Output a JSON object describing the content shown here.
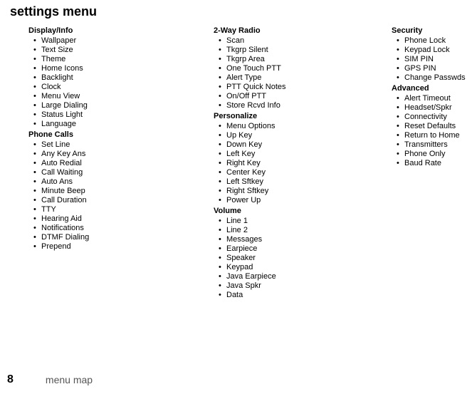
{
  "title": "settings menu",
  "footer": {
    "page": "8",
    "label": "menu map"
  },
  "cols": [
    {
      "sections": [
        {
          "heading": "Display/Info",
          "items": [
            "Wallpaper",
            "Text Size",
            "Theme",
            "Home Icons",
            "Backlight",
            "Clock",
            "Menu View",
            "Large Dialing",
            "Status Light",
            "Language"
          ]
        },
        {
          "heading": "Phone Calls",
          "items": [
            "Set Line",
            "Any Key Ans",
            "Auto Redial",
            "Call Waiting",
            "Auto Ans",
            "Minute Beep",
            "Call Duration",
            "TTY",
            "Hearing Aid",
            "Notifications",
            "DTMF Dialing",
            "Prepend"
          ]
        }
      ]
    },
    {
      "sections": [
        {
          "heading": "2-Way Radio",
          "items": [
            "Scan",
            "Tkgrp Silent",
            "Tkgrp Area",
            "One Touch PTT",
            "Alert Type",
            "PTT Quick Notes",
            "On/Off PTT",
            "Store Rcvd Info"
          ]
        },
        {
          "heading": "Personalize",
          "items": [
            "Menu Options",
            "Up Key",
            "Down Key",
            "Left Key",
            "Right Key",
            "Center Key",
            "Left Sftkey",
            "Right Sftkey",
            "Power Up"
          ]
        },
        {
          "heading": "Volume",
          "items": [
            "Line 1",
            "Line 2",
            "Messages",
            "Earpiece",
            "Speaker",
            "Keypad",
            "Java Earpiece",
            "Java Spkr",
            "Data"
          ]
        }
      ]
    },
    {
      "sections": [
        {
          "heading": "Security",
          "items": [
            "Phone Lock",
            "Keypad Lock",
            "SIM PIN",
            "GPS PIN",
            "Change Passwds"
          ]
        },
        {
          "heading": "Advanced",
          "items": [
            "Alert Timeout",
            "Headset/Spkr",
            "Connectivity",
            "Reset Defaults",
            "Return to Home",
            "Transmitters",
            "Phone Only",
            "Baud Rate"
          ]
        }
      ]
    }
  ]
}
